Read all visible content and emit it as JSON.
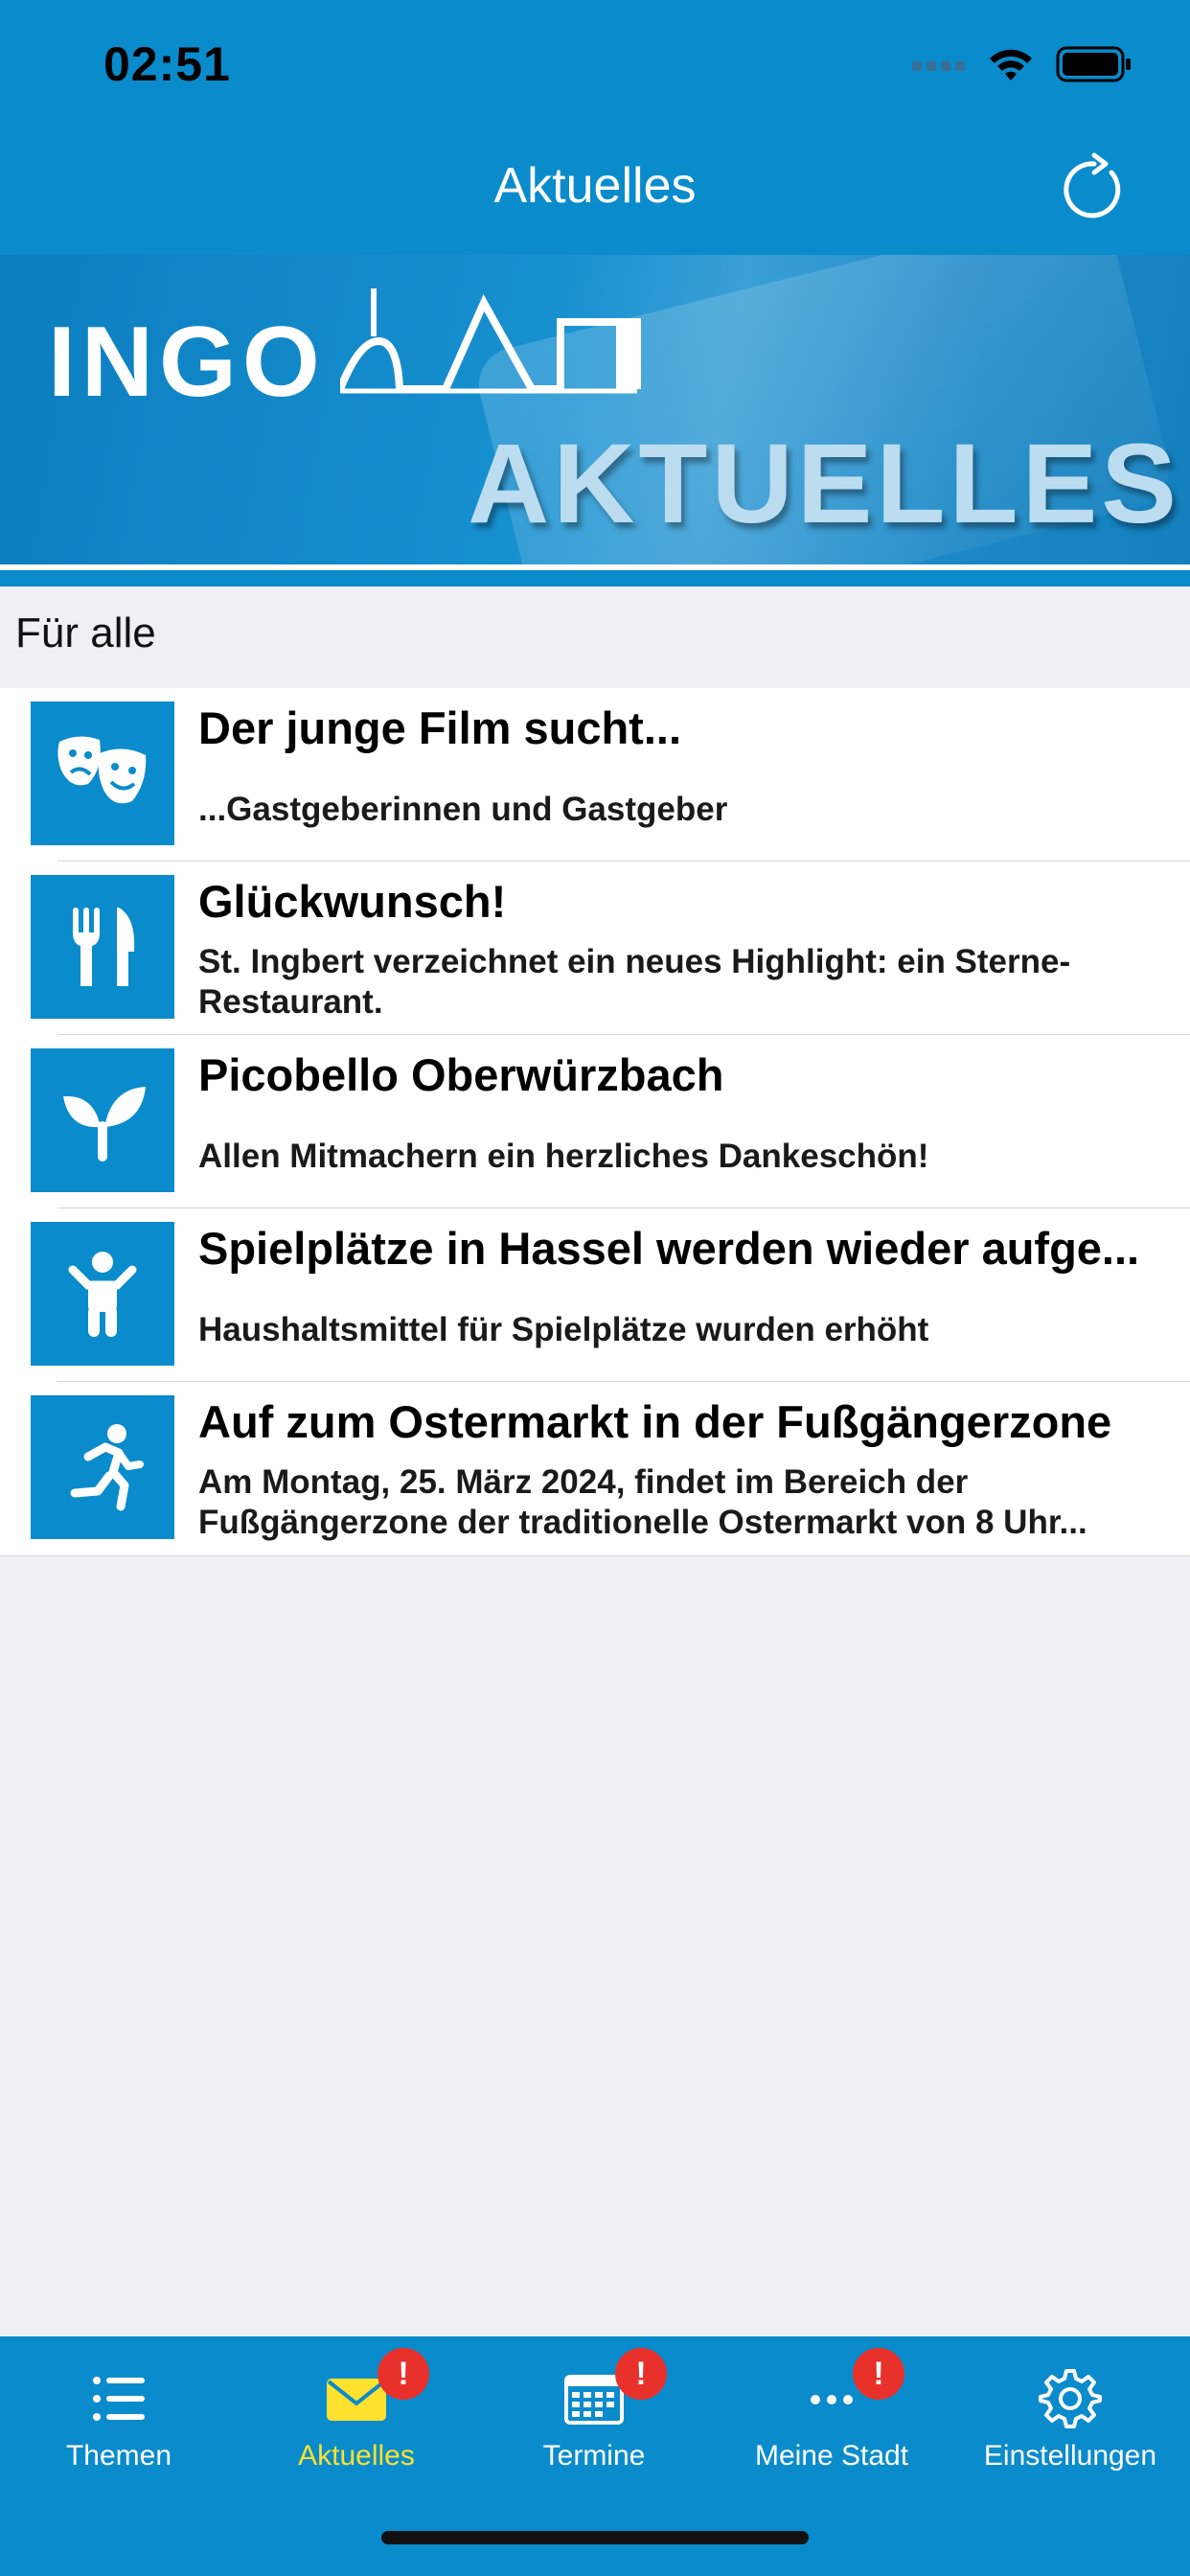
{
  "status_bar": {
    "time": "02:51"
  },
  "nav": {
    "title": "Aktuelles"
  },
  "banner": {
    "logo": "INGO",
    "subtitle": "AKTUELLES"
  },
  "section": {
    "label": "Für alle"
  },
  "news": [
    {
      "icon": "theater-masks-icon",
      "title": "Der junge Film sucht...",
      "subtitle": "...Gastgeberinnen und Gastgeber"
    },
    {
      "icon": "fork-knife-icon",
      "title": "Glückwunsch!",
      "subtitle": "St. Ingbert verzeichnet ein neues Highlight: ein Sterne-Restaurant."
    },
    {
      "icon": "sprout-icon",
      "title": "Picobello Oberwürzbach",
      "subtitle": "Allen Mitmachern ein herzliches Dankeschön!"
    },
    {
      "icon": "child-icon",
      "title": "Spielplätze in Hassel werden wieder aufge...",
      "subtitle": "Haushaltsmittel für Spielplätze wurden erhöht"
    },
    {
      "icon": "running-person-icon",
      "title": "Auf zum Ostermarkt in der Fußgängerzone",
      "subtitle": "Am Montag, 25. März 2024, findet im Bereich der Fußgängerzone der traditionelle Ostermarkt von 8 Uhr..."
    }
  ],
  "tabs": [
    {
      "label": "Themen",
      "icon": "list-icon",
      "badge": ""
    },
    {
      "label": "Aktuelles",
      "icon": "envelope-icon",
      "badge": "!",
      "active": true
    },
    {
      "label": "Termine",
      "icon": "calendar-icon",
      "badge": "!"
    },
    {
      "label": "Meine Stadt",
      "icon": "more-dots-icon",
      "badge": "!"
    },
    {
      "label": "Einstellungen",
      "icon": "gear-icon",
      "badge": ""
    }
  ],
  "colors": {
    "brand_blue": "#0a8bcc",
    "active_tab": "#ffe12e",
    "badge_red": "#e8312b"
  }
}
